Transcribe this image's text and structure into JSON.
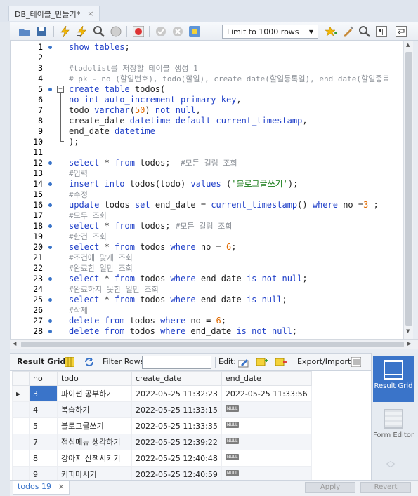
{
  "tab": {
    "title": "DB_테이블_만들기*",
    "close": "×"
  },
  "toolbar": {
    "limit_label": "Limit to 1000 rows"
  },
  "editor": {
    "lines": [
      {
        "n": "1",
        "dot": true,
        "html": "<span class='k'>show tables</span>;"
      },
      {
        "n": "2",
        "dot": false,
        "html": ""
      },
      {
        "n": "3",
        "dot": false,
        "html": "<span class='c'>#todolist를 저장할 테이블 생성 1</span>"
      },
      {
        "n": "4",
        "dot": false,
        "html": "<span class='c'># pk - no (할일번호), todo(할일), create_date(할일등록일), end_date(할일종료</span>"
      },
      {
        "n": "5",
        "dot": true,
        "fold": "−",
        "html": "<span class='k'>create table</span> todos("
      },
      {
        "n": "6",
        "dot": false,
        "html": "<span class='k'>no int auto_increment primary key</span>,"
      },
      {
        "n": "7",
        "dot": false,
        "html": "todo <span class='k'>varchar</span>(<span class='n'>50</span>) <span class='k'>not null</span>,"
      },
      {
        "n": "8",
        "dot": false,
        "html": "create_date <span class='k'>datetime default current_timestamp</span>,"
      },
      {
        "n": "9",
        "dot": false,
        "html": "end_date <span class='k'>datetime</span>"
      },
      {
        "n": "10",
        "dot": false,
        "html": ");"
      },
      {
        "n": "11",
        "dot": false,
        "html": ""
      },
      {
        "n": "12",
        "dot": true,
        "html": "<span class='k'>select</span> * <span class='k'>from</span> todos;  <span class='c'>#모든 컬럼 조회</span>"
      },
      {
        "n": "13",
        "dot": false,
        "html": "<span class='c'>#입력</span>"
      },
      {
        "n": "14",
        "dot": true,
        "html": "<span class='k'>insert into</span> todos(todo) <span class='k'>values</span> (<span class='s'>'블로그글쓰기'</span>);"
      },
      {
        "n": "15",
        "dot": false,
        "html": "<span class='c'>#수정</span>"
      },
      {
        "n": "16",
        "dot": true,
        "html": "<span class='k'>update</span> todos <span class='k'>set</span> end_date = <span class='fn'>current_timestamp</span>() <span class='k'>where</span> no =<span class='n'>3</span> ;"
      },
      {
        "n": "17",
        "dot": false,
        "html": "<span class='c'>#모두 조회</span>"
      },
      {
        "n": "18",
        "dot": true,
        "html": "<span class='k'>select</span> * <span class='k'>from</span> todos; <span class='c'>#모든 컬럼 조회</span>"
      },
      {
        "n": "19",
        "dot": false,
        "html": "<span class='c'>#한건 조회</span>"
      },
      {
        "n": "20",
        "dot": true,
        "html": "<span class='k'>select</span> * <span class='k'>from</span> todos <span class='k'>where</span> no = <span class='n'>6</span>;"
      },
      {
        "n": "21",
        "dot": false,
        "html": "<span class='c'>#조건에 맞게 조회</span>"
      },
      {
        "n": "22",
        "dot": false,
        "html": "<span class='c'>#완료한 일만 조회</span>"
      },
      {
        "n": "23",
        "dot": true,
        "html": "<span class='k'>select</span> * <span class='k'>from</span> todos <span class='k'>where</span> end_date <span class='k'>is not null</span>;"
      },
      {
        "n": "24",
        "dot": false,
        "html": "<span class='c'>#완료하지 못한 일만 조회</span>"
      },
      {
        "n": "25",
        "dot": true,
        "html": "<span class='k'>select</span> * <span class='k'>from</span> todos <span class='k'>where</span> end_date <span class='k'>is null</span>;"
      },
      {
        "n": "26",
        "dot": false,
        "html": "<span class='c'>#삭제</span>"
      },
      {
        "n": "27",
        "dot": true,
        "html": "<span class='k'>delete from</span> todos <span class='k'>where</span> no = <span class='n'>6</span>;"
      },
      {
        "n": "28",
        "dot": true,
        "html": "<span class='k'>delete from</span> todos <span class='k'>where</span> end_date <span class='k'>is not null</span>;"
      }
    ]
  },
  "results": {
    "toolbar": {
      "result_grid": "Result Grid",
      "filter_rows": "Filter Rows:",
      "edit": "Edit:",
      "export": "Export/Import:"
    },
    "columns": [
      "no",
      "todo",
      "create_date",
      "end_date"
    ],
    "null_label": "NULL",
    "rows": [
      {
        "no": "3",
        "todo": "파이썬 공부하기",
        "create_date": "2022-05-25 11:32:23",
        "end_date": "2022-05-25 11:33:56"
      },
      {
        "no": "4",
        "todo": "복습하기",
        "create_date": "2022-05-25 11:33:15",
        "end_date": null
      },
      {
        "no": "5",
        "todo": "블로그글쓰기",
        "create_date": "2022-05-25 11:33:35",
        "end_date": null
      },
      {
        "no": "7",
        "todo": "점심메뉴 생각하기",
        "create_date": "2022-05-25 12:39:22",
        "end_date": null
      },
      {
        "no": "8",
        "todo": "강아지 산책시키기",
        "create_date": "2022-05-25 12:40:48",
        "end_date": null
      },
      {
        "no": "9",
        "todo": "커피마시기",
        "create_date": "2022-05-25 12:40:59",
        "end_date": null
      }
    ]
  },
  "side": {
    "result_grid": "Result Grid",
    "form_editor": "Form Editor"
  },
  "bottom": {
    "tab": "todos 19",
    "close": "×",
    "apply": "Apply",
    "revert": "Revert"
  }
}
